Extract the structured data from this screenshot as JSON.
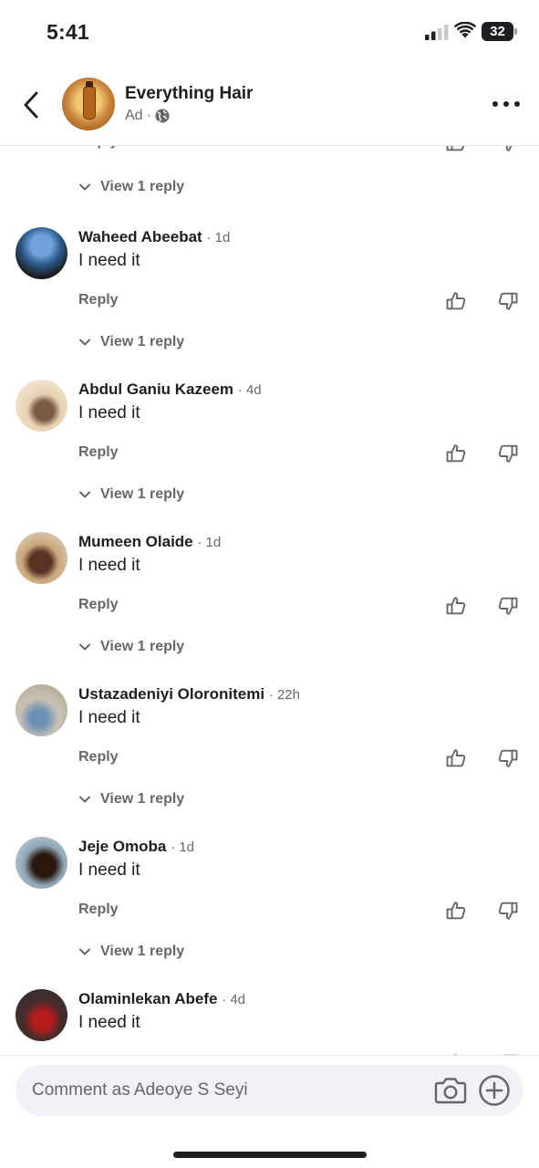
{
  "status_bar": {
    "time": "5:41",
    "battery_level": "32",
    "icons": [
      "signal-icon",
      "wifi-icon",
      "battery-icon"
    ]
  },
  "header": {
    "page_name": "Everything Hair",
    "sub_label": "Ad",
    "separator": "·",
    "icons": [
      "back-icon",
      "globe-icon",
      "more-icon"
    ]
  },
  "labels": {
    "reply": "Reply",
    "view_replies": "View 1 reply"
  },
  "comments": [
    {
      "author": "Waheed Abeebat",
      "time": "1d",
      "text": "I need it"
    },
    {
      "author": "Abdul Ganiu Kazeem",
      "time": "4d",
      "text": "I need it"
    },
    {
      "author": "Mumeen Olaide",
      "time": "1d",
      "text": "I need it"
    },
    {
      "author": "Ustazadeniyi Oloronitemi",
      "time": "22h",
      "text": "I need it"
    },
    {
      "author": "Jeje Omoba",
      "time": "1d",
      "text": "I need it"
    },
    {
      "author": "Olaminlekan Abefe",
      "time": "4d",
      "text": "I need it"
    }
  ],
  "composer": {
    "placeholder": "Comment as Adeoye S Seyi",
    "icons": [
      "camera-icon",
      "add-icon"
    ]
  },
  "colors": {
    "primary_text": "#1c1e21",
    "secondary_text": "#65676b",
    "input_bg": "#f0f2f5"
  }
}
